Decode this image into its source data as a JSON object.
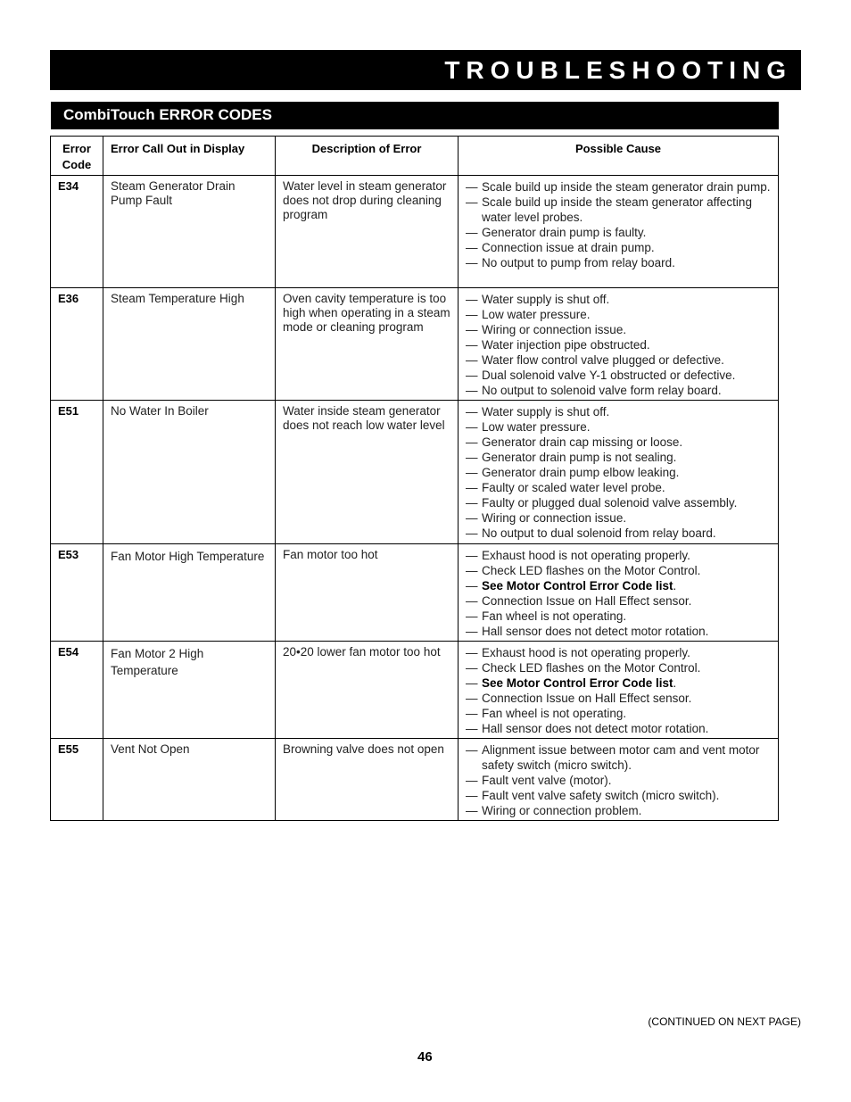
{
  "header": {
    "title": "TROUBLESHOOTING"
  },
  "section": {
    "title": "CombiTouch ERROR CODES"
  },
  "table": {
    "columns": [
      "Error Code",
      "Error Call Out in Display",
      "Description of Error",
      "Possible Cause"
    ],
    "rows": [
      {
        "code": "E34",
        "callout": "Steam Generator Drain Pump Fault",
        "description": "Water level in steam generator does not drop during cleaning program",
        "causes": [
          {
            "text": "Scale build up inside the steam generator drain pump.",
            "bold": false
          },
          {
            "text": "Scale build up inside the steam generator affecting water level probes.",
            "bold": false
          },
          {
            "text": "Generator drain pump is faulty.",
            "bold": false
          },
          {
            "text": "Connection issue at drain pump.",
            "bold": false
          },
          {
            "text": "No output to pump from relay board.",
            "bold": false
          }
        ]
      },
      {
        "code": "E36",
        "callout": "Steam Temperature High",
        "description": "Oven cavity temperature is too high when operating in a steam mode or cleaning program",
        "causes": [
          {
            "text": "Water supply is shut off.",
            "bold": false
          },
          {
            "text": "Low water pressure.",
            "bold": false
          },
          {
            "text": "Wiring or connection issue.",
            "bold": false
          },
          {
            "text": "Water injection pipe obstructed.",
            "bold": false
          },
          {
            "text": "Water flow control valve plugged or defective.",
            "bold": false
          },
          {
            "text": "Dual solenoid valve Y-1 obstructed or defective.",
            "bold": false
          },
          {
            "text": "No output to solenoid valve form relay board.",
            "bold": false
          }
        ]
      },
      {
        "code": "E51",
        "callout": "No Water In Boiler",
        "description": "Water inside steam generator does not reach low water level",
        "causes": [
          {
            "text": "Water supply is shut off.",
            "bold": false
          },
          {
            "text": "Low water pressure.",
            "bold": false
          },
          {
            "text": "Generator drain cap missing or loose.",
            "bold": false
          },
          {
            "text": "Generator drain pump is not sealing.",
            "bold": false
          },
          {
            "text": "Generator drain pump elbow leaking.",
            "bold": false
          },
          {
            "text": "Faulty or scaled water level probe.",
            "bold": false
          },
          {
            "text": "Faulty or plugged dual solenoid valve assembly.",
            "bold": false
          },
          {
            "text": "Wiring or connection issue.",
            "bold": false
          },
          {
            "text": "No output to dual solenoid from relay board.",
            "bold": false
          }
        ]
      },
      {
        "code": "E53",
        "callout": "Fan Motor High Temperature",
        "description": "Fan motor too hot",
        "causes": [
          {
            "text": "Exhaust hood is not operating properly.",
            "bold": false
          },
          {
            "text": "Check LED flashes on the Motor Control.",
            "bold": false
          },
          {
            "text": "See Motor Control Error Code list",
            "bold": true,
            "suffix": "."
          },
          {
            "text": "Connection Issue on Hall Effect sensor.",
            "bold": false
          },
          {
            "text": "Fan wheel is not operating.",
            "bold": false
          },
          {
            "text": "Hall sensor does not detect motor rotation.",
            "bold": false
          }
        ]
      },
      {
        "code": "E54",
        "callout": "Fan Motor 2 High Temperature",
        "description": "20•20 lower fan motor too hot",
        "causes": [
          {
            "text": "Exhaust hood is not operating properly.",
            "bold": false
          },
          {
            "text": "Check LED flashes on the Motor Control.",
            "bold": false
          },
          {
            "text": "See Motor Control Error Code list",
            "bold": true,
            "suffix": "."
          },
          {
            "text": "Connection Issue on Hall Effect sensor.",
            "bold": false
          },
          {
            "text": "Fan wheel is not operating.",
            "bold": false
          },
          {
            "text": "Hall sensor does not detect motor rotation.",
            "bold": false
          }
        ]
      },
      {
        "code": "E55",
        "callout": "Vent Not Open",
        "description": "Browning valve does not open",
        "causes": [
          {
            "text": "Alignment issue between motor cam and vent motor safety switch (micro switch).",
            "bold": false
          },
          {
            "text": "Fault vent valve (motor).",
            "bold": false
          },
          {
            "text": "Fault vent valve safety switch (micro switch).",
            "bold": false
          },
          {
            "text": "Wiring or connection problem.",
            "bold": false
          }
        ]
      }
    ]
  },
  "footer": {
    "continued": "(CONTINUED ON NEXT PAGE)",
    "page_number": "46"
  },
  "dash": "—"
}
